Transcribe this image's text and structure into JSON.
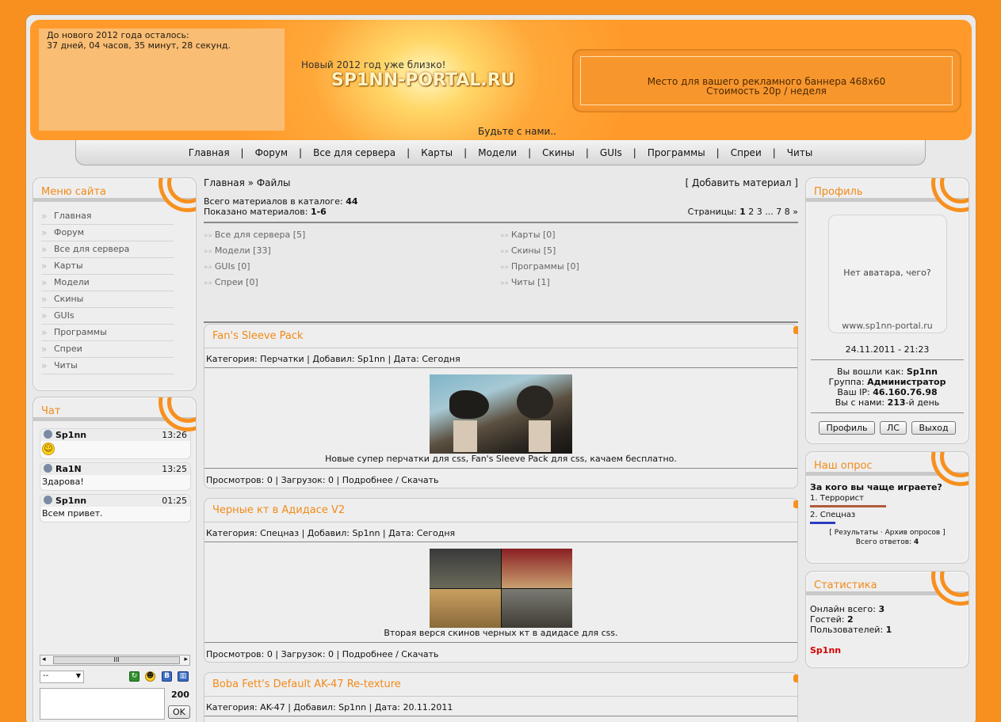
{
  "header": {
    "countdown_line1": "До нового 2012 года осталось:",
    "countdown_line2": "37 дней, 04 часов, 35 минут, 28 секунд.",
    "slogan": "Новый 2012 год уже близко!",
    "site_title": "SP1NN-PORTAL.RU",
    "subtitle": "Будьте с нами..",
    "banner_line1": "Место для вашего рекламного баннера 468x60",
    "banner_line2": "Стоимость 20р / неделя"
  },
  "nav": {
    "items": [
      "Главная",
      "Форум",
      "Все для сервера",
      "Карты",
      "Модели",
      "Скины",
      "GUIs",
      "Программы",
      "Спреи",
      "Читы"
    ],
    "separator": "|"
  },
  "menu": {
    "title": "Меню сайта",
    "items": [
      "Главная",
      "Форум",
      "Все для сервера",
      "Карты",
      "Модели",
      "Скины",
      "GUIs",
      "Программы",
      "Спреи",
      "Читы"
    ]
  },
  "chat": {
    "title": "Чат",
    "messages": [
      {
        "user": "Sp1nn",
        "time": "13:26",
        "text": ""
      },
      {
        "user": "Ra1N",
        "time": "13:25",
        "text": "Здарова!"
      },
      {
        "user": "Sp1nn",
        "time": "01:25",
        "text": "Всем привет."
      }
    ],
    "scroll_grip": "III",
    "select_value": "--",
    "char_count": "200",
    "ok_label": "OK"
  },
  "content": {
    "breadcrumb_home": "Главная",
    "breadcrumb_sep": "»",
    "breadcrumb_current": "Файлы",
    "add_material": "[ Добавить материал ]",
    "total_label": "Всего материалов в каталоге:",
    "total_value": "44",
    "shown_label": "Показано материалов:",
    "shown_value": "1-6",
    "pages_label": "Страницы:",
    "pages": [
      "1",
      "2",
      "3",
      "...",
      "7",
      "8",
      "»"
    ],
    "categories": [
      {
        "name": "Все для сервера",
        "count": "[5]"
      },
      {
        "name": "Карты",
        "count": "[0]"
      },
      {
        "name": "Модели",
        "count": "[33]"
      },
      {
        "name": "Скины",
        "count": "[5]"
      },
      {
        "name": "GUIs",
        "count": "[0]"
      },
      {
        "name": "Программы",
        "count": "[0]"
      },
      {
        "name": "Спреи",
        "count": "[0]"
      },
      {
        "name": "Читы",
        "count": "[1]"
      }
    ],
    "entries": [
      {
        "title": "Fan's Sleeve Pack",
        "meta": "Категория: Перчатки | Добавил: Sp1nn | Дата: Сегодня",
        "description": "Новые супер перчатки для css, Fan's Sleeve Pack для css, качаем бесплатно.",
        "footer": "Просмотров: 0 | Загрузок: 0 | Подробнее / Скачать"
      },
      {
        "title": "Черные кт в Адидасе V2",
        "meta": "Категория: Спецназ | Добавил: Sp1nn | Дата: Сегодня",
        "description": "Вторая верся скинов черных кт в адидасе для css.",
        "footer": "Просмотров: 0 | Загрузок: 0 | Подробнее / Скачать"
      },
      {
        "title": "Boba Fett's Default AK-47 Re-texture",
        "meta": "Категория: AK-47 | Добавил: Sp1nn | Дата: 20.11.2011",
        "description": "",
        "footer": ""
      }
    ]
  },
  "profile": {
    "title": "Профиль",
    "avatar_text": "Нет аватара, чего?",
    "avatar_url": "www.sp1nn-portal.ru",
    "datetime": "24.11.2011 - 21:23",
    "logged_label": "Вы вошли как:",
    "logged_user": "Sp1nn",
    "group_label": "Группа:",
    "group_value": "Администратор",
    "ip_label": "Ваш IP:",
    "ip_value": "46.160.76.98",
    "days_label_pre": "Вы с нами:",
    "days_value": "213",
    "days_label_post": "-й день",
    "btn_profile": "Профиль",
    "btn_pm": "ЛС",
    "btn_logout": "Выход"
  },
  "poll": {
    "title": "Наш опрос",
    "question": "За кого вы чаще играете?",
    "options": [
      {
        "label": "1. Террорист",
        "share": 0.5,
        "color": "#b05a3a"
      },
      {
        "label": "2. Спецназ",
        "share": 0.17,
        "color": "#2a3cc0"
      }
    ],
    "results_link": "Результаты",
    "archive_link": "Архив опросов",
    "total_label": "Всего ответов:",
    "total_value": "4"
  },
  "stats": {
    "title": "Статистика",
    "online_label": "Онлайн всего:",
    "online_value": "3",
    "guests_label": "Гостей:",
    "guests_value": "2",
    "users_label": "Пользователей:",
    "users_value": "1",
    "online_user": "Sp1nn"
  },
  "colors": {
    "accent": "#f7901f",
    "title_orange": "#f28a18",
    "online_user": "#d60000"
  }
}
